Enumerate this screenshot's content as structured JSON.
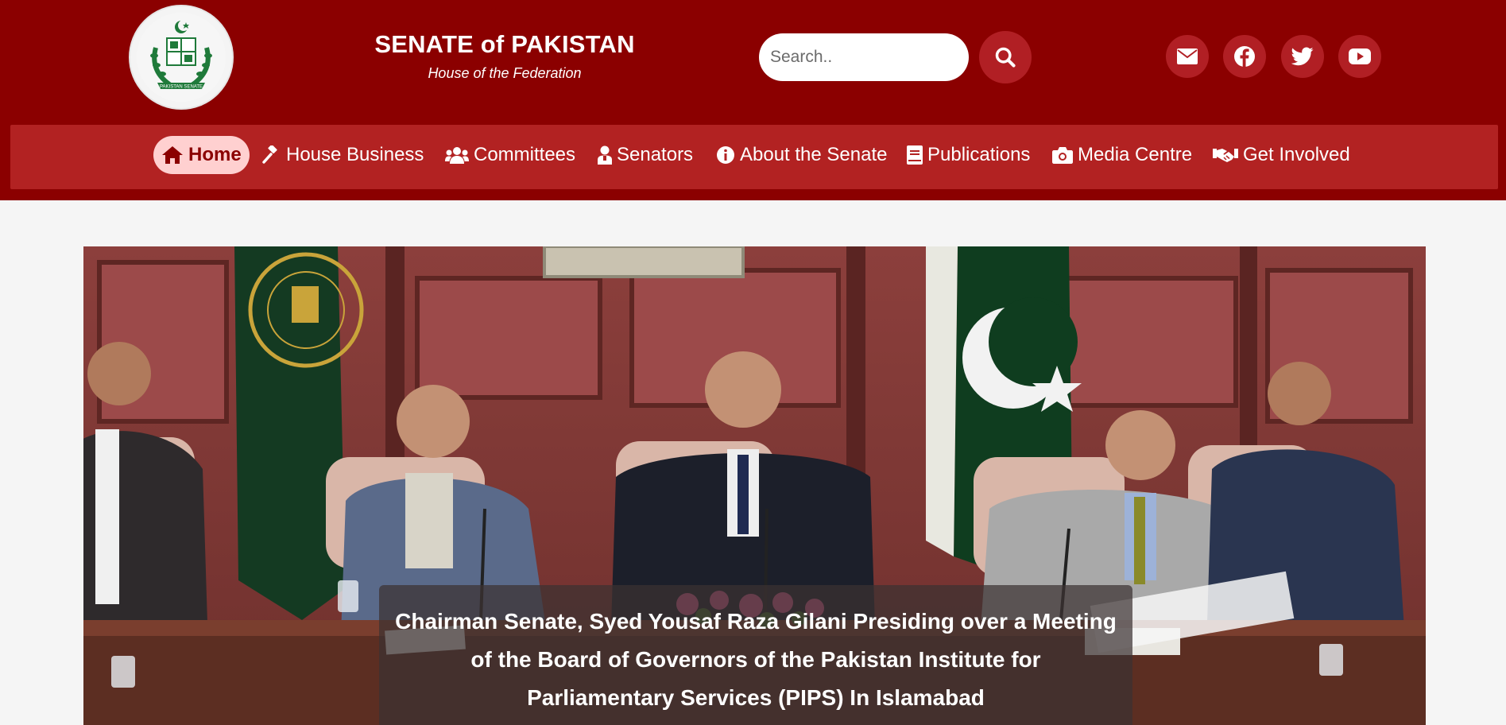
{
  "header": {
    "title": "SENATE of PAKISTAN",
    "subtitle": "House of the Federation",
    "logo": {
      "icon": "senate-emblem-icon",
      "text": "PAKISTAN SENATE"
    }
  },
  "search": {
    "placeholder": "Search..",
    "value": "",
    "icon": "search-icon"
  },
  "social": [
    {
      "name": "email",
      "icon": "envelope-icon"
    },
    {
      "name": "facebook",
      "icon": "facebook-icon"
    },
    {
      "name": "twitter",
      "icon": "twitter-icon"
    },
    {
      "name": "youtube",
      "icon": "youtube-icon"
    }
  ],
  "nav": {
    "items": [
      {
        "label": "Home",
        "icon": "home-icon",
        "active": true
      },
      {
        "label": "House Business",
        "icon": "gavel-icon"
      },
      {
        "label": "Committees",
        "icon": "users-icon"
      },
      {
        "label": "Senators",
        "icon": "user-icon"
      },
      {
        "label": "About the Senate",
        "icon": "info-icon"
      },
      {
        "label": "Publications",
        "icon": "book-icon"
      },
      {
        "label": "Media Centre",
        "icon": "camera-icon"
      },
      {
        "label": "Get Involved",
        "icon": "handshake-icon"
      }
    ]
  },
  "hero": {
    "caption": "Chairman Senate, Syed Yousaf Raza Gilani Presiding over a Meeting of the Board of Governors of the Pakistan Institute for Parliamentary Services (PIPS) In Islamabad"
  },
  "colors": {
    "header_bg": "#8b0000",
    "nav_bg": "#b22222",
    "accent": "#b11f24",
    "active_pill": "#ffd0d0",
    "page_bg": "#f5f5f5"
  }
}
